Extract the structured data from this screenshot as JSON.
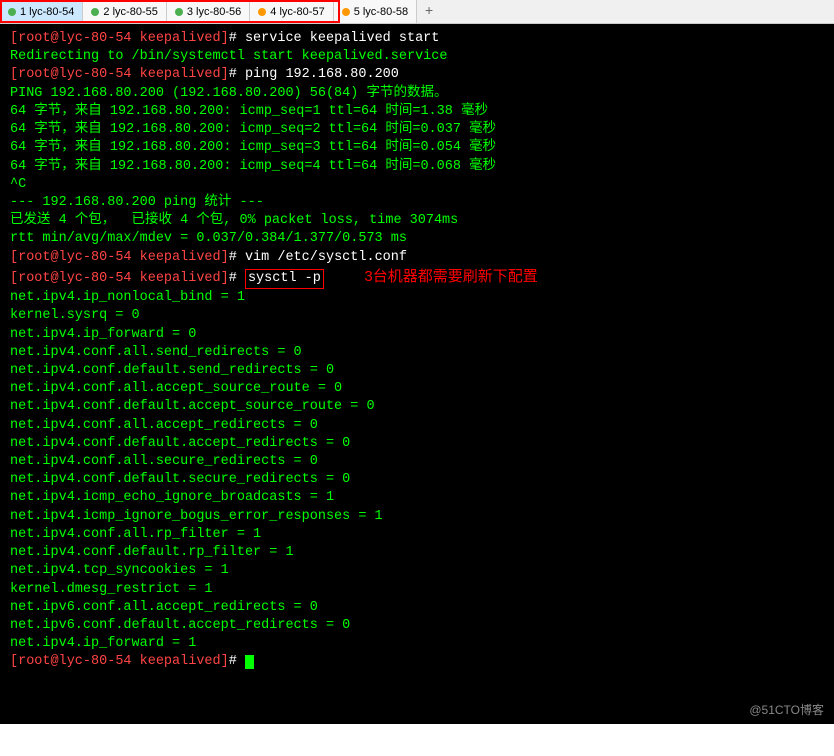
{
  "tabs": [
    {
      "label": "1 lyc-80-54",
      "dot": "green",
      "active": true
    },
    {
      "label": "2 lyc-80-55",
      "dot": "green",
      "active": false
    },
    {
      "label": "3 lyc-80-56",
      "dot": "green",
      "active": false
    },
    {
      "label": "4 lyc-80-57",
      "dot": "orange",
      "active": false
    },
    {
      "label": "5 lyc-80-58",
      "dot": "orange",
      "active": false
    }
  ],
  "new_tab": "+",
  "annotation": "3台机器都需要刷新下配置",
  "prompt": {
    "user_host": "[root@lyc-80-54 keepalived]",
    "suffix": "# "
  },
  "commands": {
    "cmd1": "service keepalived start",
    "cmd2": "ping 192.168.80.200",
    "cmd3": "vim /etc/sysctl.conf",
    "cmd4": "sysctl -p"
  },
  "output": {
    "redirect": "Redirecting to /bin/systemctl start keepalived.service",
    "ping_header": "PING 192.168.80.200 (192.168.80.200) 56(84) 字节的数据。",
    "ping1": "64 字节，来自 192.168.80.200: icmp_seq=1 ttl=64 时间=1.38 毫秒",
    "ping2": "64 字节，来自 192.168.80.200: icmp_seq=2 ttl=64 时间=0.037 毫秒",
    "ping3": "64 字节，来自 192.168.80.200: icmp_seq=3 ttl=64 时间=0.054 毫秒",
    "ping4": "64 字节，来自 192.168.80.200: icmp_seq=4 ttl=64 时间=0.068 毫秒",
    "ctrlc": "^C",
    "ping_stats_hdr": "--- 192.168.80.200 ping 统计 ---",
    "ping_stats1": "已发送 4 个包，  已接收 4 个包, 0% packet loss, time 3074ms",
    "ping_stats2": "rtt min/avg/max/mdev = 0.037/0.384/1.377/0.573 ms",
    "s1": "net.ipv4.ip_nonlocal_bind = 1",
    "s2": "kernel.sysrq = 0",
    "s3": "net.ipv4.ip_forward = 0",
    "s4": "net.ipv4.conf.all.send_redirects = 0",
    "s5": "net.ipv4.conf.default.send_redirects = 0",
    "s6": "net.ipv4.conf.all.accept_source_route = 0",
    "s7": "net.ipv4.conf.default.accept_source_route = 0",
    "s8": "net.ipv4.conf.all.accept_redirects = 0",
    "s9": "net.ipv4.conf.default.accept_redirects = 0",
    "s10": "net.ipv4.conf.all.secure_redirects = 0",
    "s11": "net.ipv4.conf.default.secure_redirects = 0",
    "s12": "net.ipv4.icmp_echo_ignore_broadcasts = 1",
    "s13": "net.ipv4.icmp_ignore_bogus_error_responses = 1",
    "s14": "net.ipv4.conf.all.rp_filter = 1",
    "s15": "net.ipv4.conf.default.rp_filter = 1",
    "s16": "net.ipv4.tcp_syncookies = 1",
    "s17": "kernel.dmesg_restrict = 1",
    "s18": "net.ipv6.conf.all.accept_redirects = 0",
    "s19": "net.ipv6.conf.default.accept_redirects = 0",
    "s20": "net.ipv4.ip_forward = 1"
  },
  "watermark": "@51CTO博客"
}
